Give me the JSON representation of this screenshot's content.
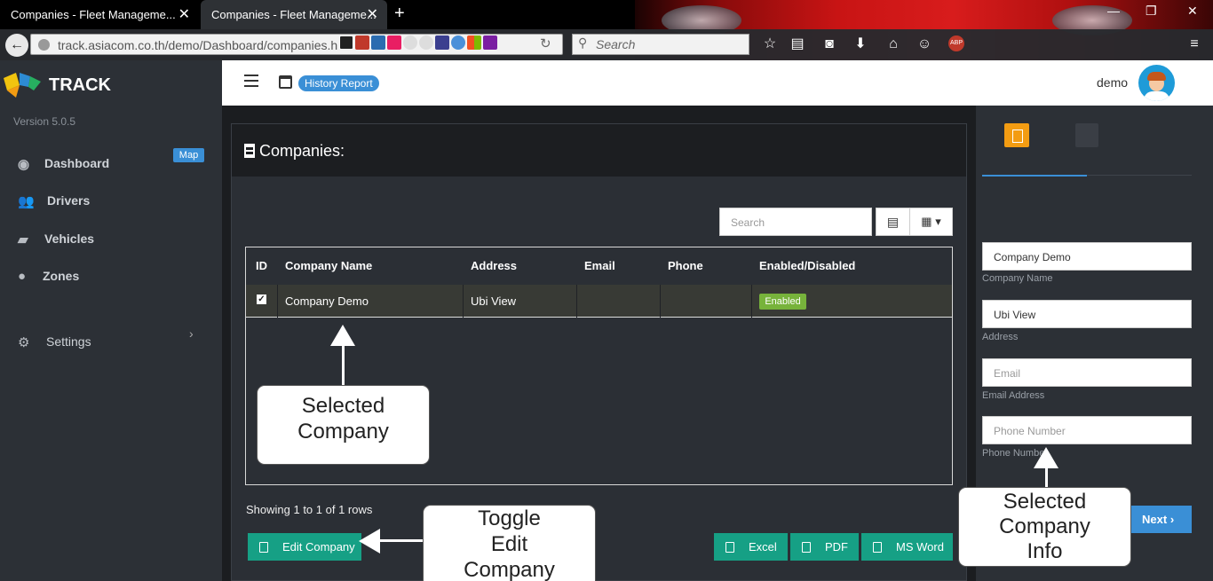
{
  "browser": {
    "tabs": [
      {
        "title": "Companies - Fleet Manageme...",
        "active": false
      },
      {
        "title": "Companies - Fleet Manageme...",
        "active": true
      }
    ],
    "url": "track.asiacom.co.th/demo/Dashboard/companies.h",
    "search_placeholder": "Search"
  },
  "sidebar": {
    "brand": "TRACK",
    "version": "Version 5.0.5",
    "items": [
      {
        "label": "Dashboard",
        "icon": "dashboard-icon",
        "badge": "Map"
      },
      {
        "label": "Drivers",
        "icon": "users-icon"
      },
      {
        "label": "Vehicles",
        "icon": "truck-icon"
      },
      {
        "label": "Zones",
        "icon": "globe-icon"
      },
      {
        "label": "Settings",
        "icon": "gears-icon"
      }
    ]
  },
  "header": {
    "history_pill": "History Report",
    "user": "demo"
  },
  "main": {
    "title": "Companies:",
    "search_placeholder": "Search",
    "table": {
      "columns": [
        "ID",
        "Company Name",
        "Address",
        "Email",
        "Phone",
        "Enabled/Disabled"
      ],
      "rows": [
        {
          "checked": true,
          "company_name": "Company Demo",
          "address": "Ubi View",
          "email": "",
          "phone": "",
          "status": "Enabled"
        }
      ]
    },
    "rows_info": "Showing 1 to 1 of 1 rows",
    "buttons": {
      "edit": "Edit Company",
      "excel": "Excel",
      "pdf": "PDF",
      "word": "MS Word"
    }
  },
  "right_panel": {
    "fields": [
      {
        "value": "Company Demo",
        "placeholder": "",
        "label": "Company Name"
      },
      {
        "value": "Ubi View",
        "placeholder": "",
        "label": "Address"
      },
      {
        "value": "",
        "placeholder": "Email",
        "label": "Email Address"
      },
      {
        "value": "",
        "placeholder": "Phone Number",
        "label": "Phone Number"
      }
    ],
    "next_label": "Next"
  },
  "callouts": {
    "selected_company": [
      "Selected",
      "Company"
    ],
    "toggle_edit": [
      "Toggle",
      "Edit",
      "Company"
    ],
    "selected_info": [
      "Selected",
      "Company",
      "Info"
    ]
  },
  "colors": {
    "accent": "#3a8fd6",
    "teal_button": "#16a085",
    "enabled_green": "#77b33b",
    "active_tab_orange": "#f39c12",
    "sidebar_bg": "#2c3036"
  }
}
